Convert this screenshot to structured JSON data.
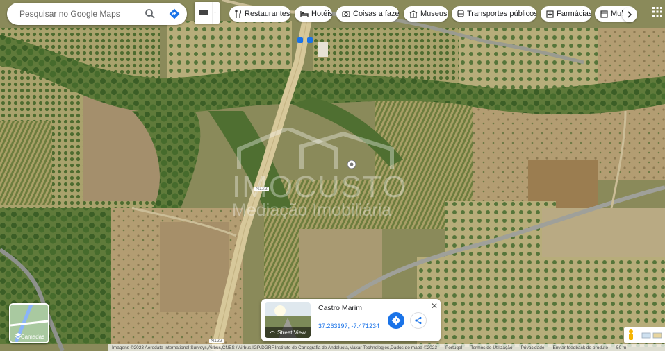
{
  "search": {
    "placeholder": "Pesquisar no Google Maps"
  },
  "chips": [
    {
      "label": "Restaurantes",
      "icon": "fork-knife-icon"
    },
    {
      "label": "Hotéis",
      "icon": "bed-icon"
    },
    {
      "label": "Coisas a fazer",
      "icon": "camera-icon"
    },
    {
      "label": "Museus",
      "icon": "museum-icon"
    },
    {
      "label": "Transportes públicos",
      "icon": "bus-icon"
    },
    {
      "label": "Farmácias",
      "icon": "pharmacy-icon"
    },
    {
      "label": "Mult",
      "icon": "atm-icon"
    }
  ],
  "map": {
    "road_label_top": "N122",
    "road_label_bottom": "N122",
    "watermark_line1": "IMOCUSTO",
    "watermark_line2": "Mediação Imobiliária"
  },
  "layers": {
    "label": "Camadas"
  },
  "place_card": {
    "title": "Castro Marim",
    "coords": "37.263197, -7.471234",
    "street_view_label": "Street View",
    "close": "✕"
  },
  "attribution": {
    "imagery": "Imagens ©2023 Aerodata International Surveys,Airbus,CNES / Airbus,IGP/DGRF,Instituto de Cartografia de Andalucía,Maxar Technologies,Dados do mapa ©2023",
    "country": "Portugal",
    "terms": "Termos de Utilização",
    "privacy": "Privacidade",
    "feedback": "Enviar feedback do produto",
    "scale": "50 m"
  },
  "colors": {
    "accent": "#1a73e8",
    "road": "#d7c89a",
    "vegetation": "#3f6b2a",
    "field": "#a7a06a"
  }
}
